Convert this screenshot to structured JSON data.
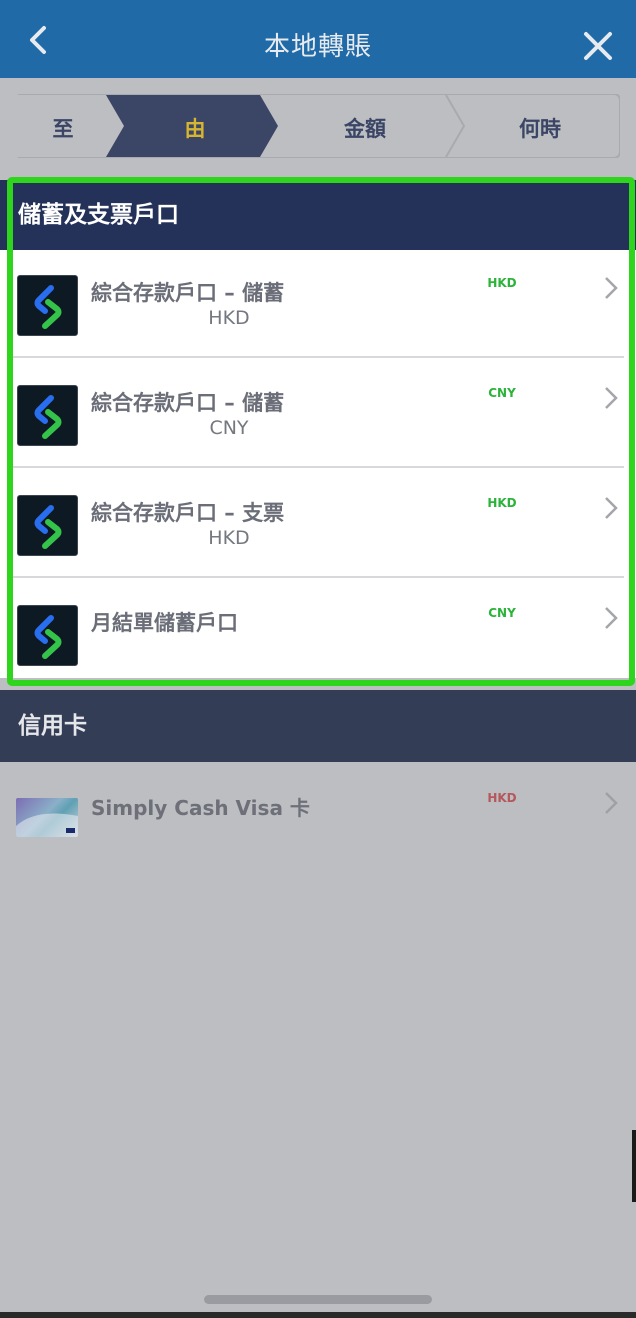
{
  "header": {
    "title": "本地轉賬"
  },
  "steps": [
    {
      "label": "至"
    },
    {
      "label": "由"
    },
    {
      "label": "金額"
    },
    {
      "label": "何時"
    }
  ],
  "savings_section": {
    "title": "儲蓄及支票戶口",
    "accounts": [
      {
        "name": "綜合存款戶口 – 儲蓄",
        "sub": "HKD",
        "currency": "HKD"
      },
      {
        "name": "綜合存款戶口 – 儲蓄",
        "sub": "CNY",
        "currency": "CNY"
      },
      {
        "name": "綜合存款戶口 – 支票",
        "sub": "HKD",
        "currency": "HKD"
      },
      {
        "name": "月結單儲蓄戶口",
        "sub": "",
        "currency": "CNY"
      }
    ]
  },
  "credit_section": {
    "title": "信用卡",
    "cards": [
      {
        "name": "Simply Cash Visa 卡",
        "currency": "HKD"
      }
    ]
  },
  "colors": {
    "header_bg": "#1f6aa7",
    "active_step_bg": "#3b4565",
    "active_step_text": "#d6b531",
    "section_bg": "#243158",
    "highlight": "#2fd41c",
    "currency_green": "#2bb33a",
    "currency_red": "#b5585b"
  }
}
